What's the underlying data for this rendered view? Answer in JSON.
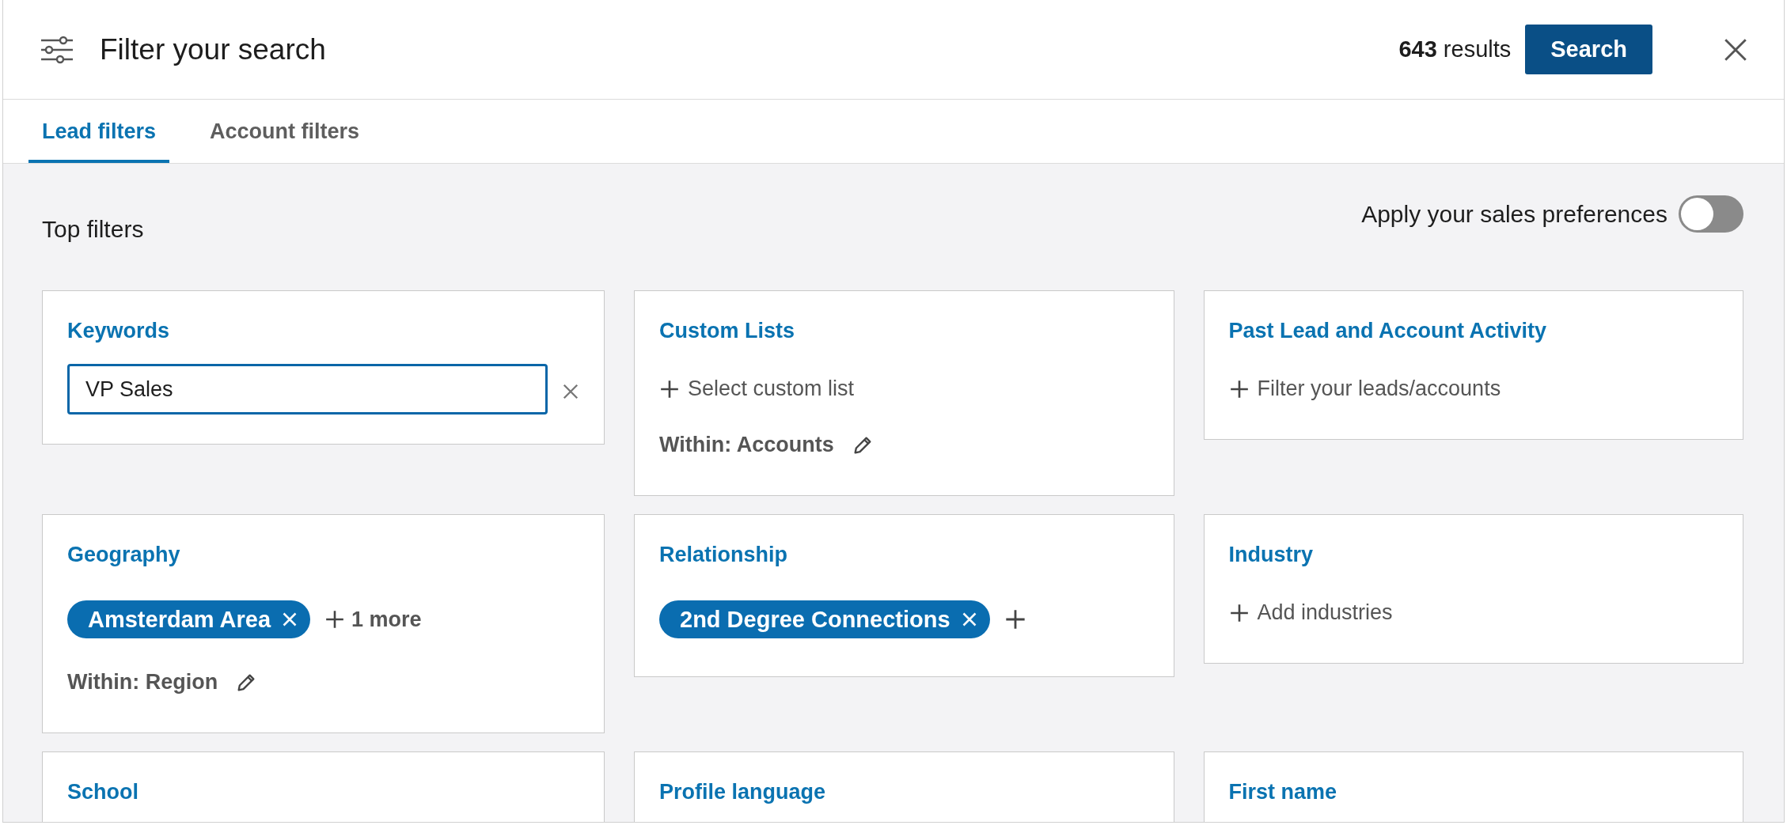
{
  "header": {
    "title": "Filter your search",
    "count": "643",
    "count_suffix": "results",
    "search_button": "Search"
  },
  "tabs": [
    {
      "label": "Lead filters",
      "selected": true
    },
    {
      "label": "Account filters",
      "selected": false
    }
  ],
  "top_filters": {
    "title": "Top filters",
    "preference_label": "Apply your sales preferences",
    "preference_on": false
  },
  "cards": [
    {
      "title": "Keywords",
      "items": [
        {
          "kind": "input",
          "value": "VP Sales"
        }
      ]
    },
    {
      "title": "Custom Lists",
      "items": [
        {
          "kind": "add",
          "label": "Select custom list"
        },
        {
          "kind": "within",
          "label": "Within: Accounts"
        }
      ]
    },
    {
      "title": "Past Lead and Account Activity",
      "items": [
        {
          "kind": "add",
          "label": "Filter your leads/accounts"
        }
      ]
    },
    {
      "title": "Geography",
      "items": [
        {
          "kind": "pills",
          "pills": [
            "Amsterdam Area"
          ],
          "more": "1 more"
        },
        {
          "kind": "within",
          "label": "Within: Region"
        }
      ]
    },
    {
      "title": "Relationship",
      "items": [
        {
          "kind": "pills",
          "pills": [
            "2nd Degree Connections"
          ]
        }
      ]
    },
    {
      "title": "Industry",
      "items": [
        {
          "kind": "add",
          "label": "Add industries"
        }
      ]
    },
    {
      "title": "School"
    },
    {
      "title": "Profile language"
    },
    {
      "title": "First name"
    }
  ]
}
